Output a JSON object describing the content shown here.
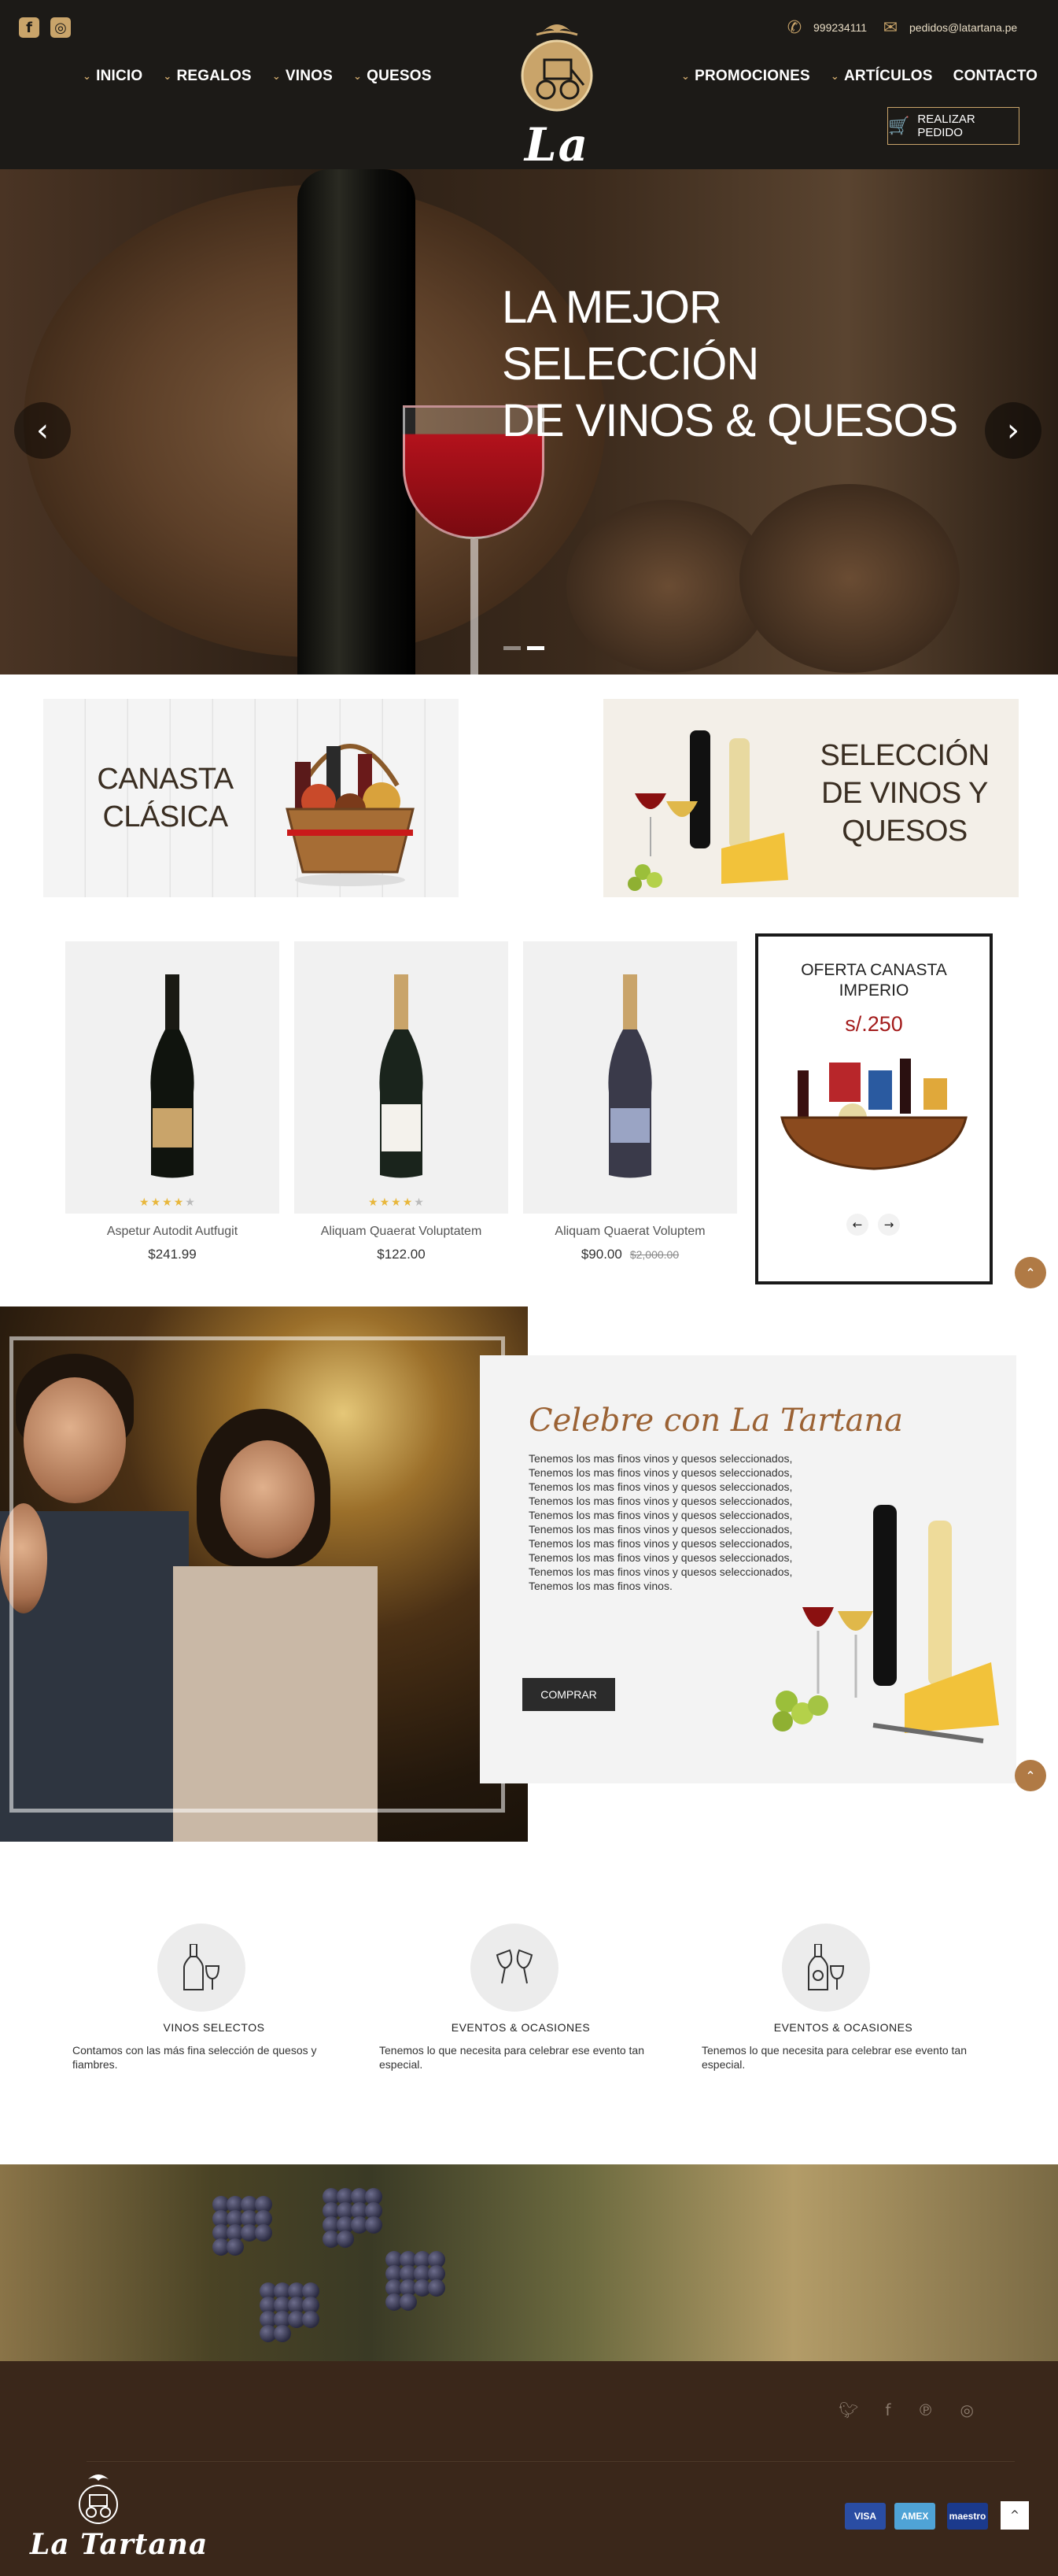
{
  "header": {
    "social": [
      {
        "icon": "facebook-icon",
        "glyph": "f"
      },
      {
        "icon": "instagram-icon",
        "glyph": "◎"
      }
    ],
    "nav_left": [
      "INICIO",
      "REGALOS",
      "VINOS",
      "QUESOS"
    ],
    "nav_right": [
      "PROMOCIONES",
      "ARTÍCULOS",
      "CONTACTO"
    ],
    "logo_text": "La Tartana",
    "phone": "999234111",
    "email": "pedidos@latartana.pe",
    "order_label": "REALIZAR PEDIDO",
    "colors": {
      "background": "#1c1a17",
      "accent": "#c9a46a"
    }
  },
  "hero": {
    "title_line1": "LA MEJOR SELECCIÓN",
    "title_line2": "DE VINOS & QUESOS",
    "prev_icon": "‹",
    "next_icon": "›",
    "active_slide": 2,
    "slide_count": 2
  },
  "promos": [
    {
      "line1": "CANASTA",
      "line2": "CLÁSICA"
    },
    {
      "line1": "SELECCIÓN",
      "line2": "DE VINOS Y",
      "line3": "QUESOS"
    }
  ],
  "products": [
    {
      "name": "Aspetur Autodit Autfugit",
      "price": "$241.99",
      "old_price": "",
      "rating": 4
    },
    {
      "name": "Aliquam Quaerat Voluptatem",
      "price": "$122.00",
      "old_price": "",
      "rating": 4
    },
    {
      "name": "Aliquam Quaerat Voluptem",
      "price": "$90.00",
      "old_price": "$2,000.00",
      "rating": 0
    }
  ],
  "offer": {
    "title_line1": "OFERTA CANASTA",
    "title_line2": "IMPERIO",
    "price": "s/.250",
    "prev": "←",
    "next": "→"
  },
  "celebrate": {
    "title": "Celebre con La Tartana",
    "body": "Tenemos los mas finos vinos y quesos seleccionados, Tenemos los mas finos vinos y quesos seleccionados, Tenemos los mas finos vinos y quesos seleccionados, Tenemos los mas finos vinos y quesos seleccionados, Tenemos los mas finos vinos y quesos seleccionados, Tenemos los mas finos vinos y quesos seleccionados, Tenemos los mas finos vinos y quesos seleccionados, Tenemos los mas finos vinos y quesos seleccionados, Tenemos los mas finos vinos y quesos seleccionados, Tenemos los mas finos vinos.",
    "button": "COMPRAR"
  },
  "features": [
    {
      "icon": "wine-bottle-glass-icon",
      "title": "VINOS SELECTOS",
      "text": "Contamos con las más fina selección de quesos y fiambres."
    },
    {
      "icon": "toast-glasses-icon",
      "title": "EVENTOS & OCASIONES",
      "text": "Tenemos lo que necesita para celebrar ese evento tan especial."
    },
    {
      "icon": "bottle-glass-icon",
      "title": "EVENTOS & OCASIONES",
      "text": "Tenemos lo que necesita para celebrar ese evento tan especial."
    }
  ],
  "footer": {
    "social": [
      "twitter-icon",
      "facebook-icon",
      "pinterest-icon",
      "instagram-icon"
    ],
    "logo_text": "La Tartana",
    "payments": [
      "VISA",
      "AMEX",
      "maestro"
    ],
    "to_top": "^"
  }
}
